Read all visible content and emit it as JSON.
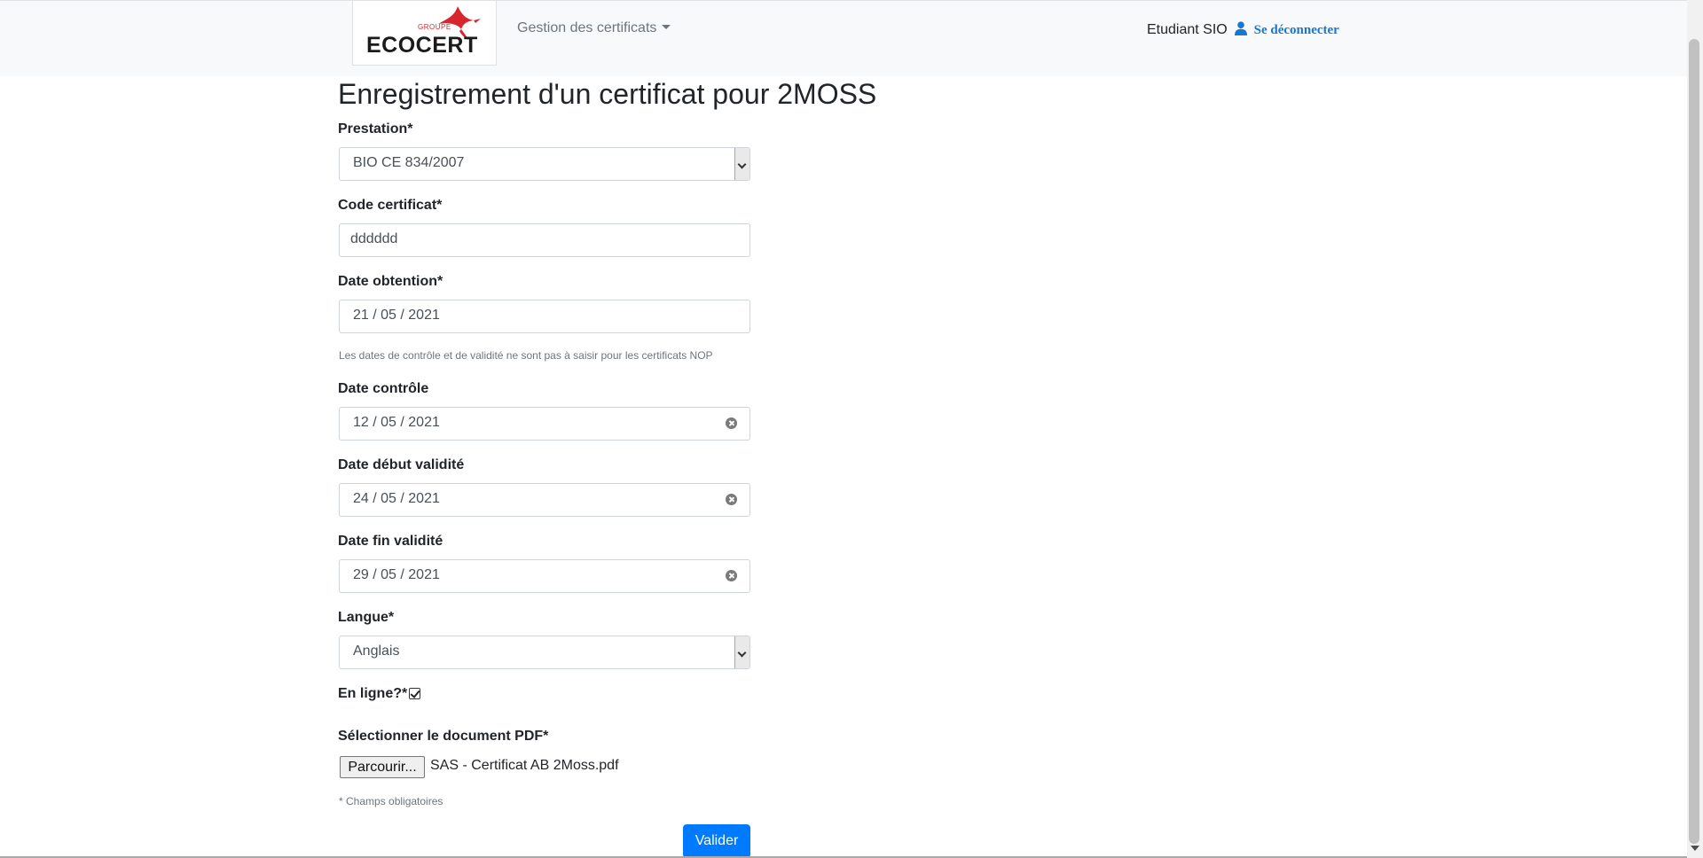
{
  "navbar": {
    "logo": {
      "small_text": "GROUPE",
      "word": "ECOCERT",
      "bird_color": "#d7262d"
    },
    "menu_label": "Gestion des certificats",
    "user_name": "Etudiant SIO",
    "logout_label": "Se déconnecter",
    "user_icon": "user-icon"
  },
  "form": {
    "title": "Enregistrement d'un certificat pour 2MOSS",
    "prestation": {
      "label": "Prestation*",
      "value": "BIO CE 834/2007"
    },
    "code": {
      "label": "Code certificat*",
      "value": "dddddd"
    },
    "date_obtention": {
      "label": "Date obtention*",
      "value": "21 / 05 / 2021"
    },
    "help_text": "Les dates de contrôle et de validité ne sont pas à saisir pour les certificats NOP",
    "date_controle": {
      "label": "Date contrôle",
      "value": "12 / 05 / 2021"
    },
    "date_debut": {
      "label": "Date début validité",
      "value": "24 / 05 / 2021"
    },
    "date_fin": {
      "label": "Date fin validité",
      "value": "29 / 05 / 2021"
    },
    "langue": {
      "label": "Langue*",
      "value": "Anglais"
    },
    "en_ligne": {
      "label": "En ligne?*",
      "checked": true
    },
    "document": {
      "label": "Sélectionner le document PDF*",
      "browse_label": "Parcourir...",
      "file_name": "SAS - Certificat AB 2Moss.pdf"
    },
    "required_note": "* Champs obligatoires",
    "submit_label": "Valider"
  },
  "colors": {
    "primary": "#007bff",
    "link": "#1678d1",
    "navbar_bg": "#f8f9fa",
    "brand_red": "#d7262d"
  }
}
